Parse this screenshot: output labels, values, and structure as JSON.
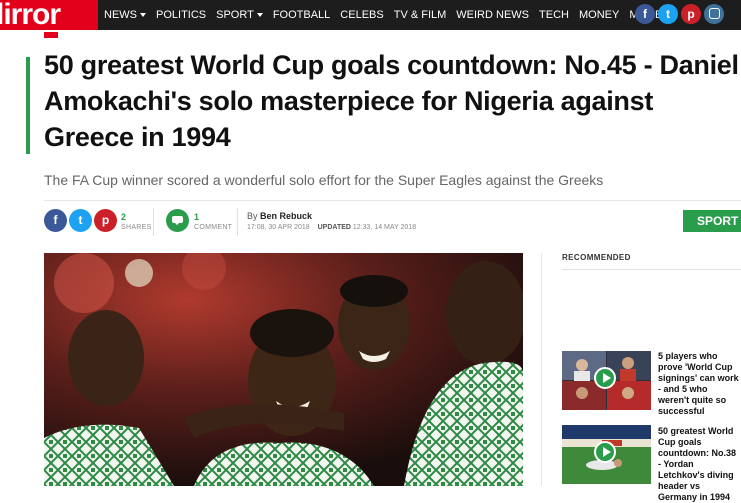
{
  "logo": {
    "text": "lirror"
  },
  "nav": {
    "items": [
      {
        "label": "NEWS",
        "dropdown": true
      },
      {
        "label": "POLITICS",
        "dropdown": false
      },
      {
        "label": "SPORT",
        "dropdown": true
      },
      {
        "label": "FOOTBALL",
        "dropdown": false
      },
      {
        "label": "CELEBS",
        "dropdown": false
      },
      {
        "label": "TV & FILM",
        "dropdown": false
      },
      {
        "label": "WEIRD NEWS",
        "dropdown": false
      },
      {
        "label": "TECH",
        "dropdown": false
      },
      {
        "label": "MONEY",
        "dropdown": false
      },
      {
        "label": "MORE",
        "dropdown": true
      }
    ],
    "social": [
      {
        "icon": "facebook-icon",
        "glyph": "f"
      },
      {
        "icon": "twitter-icon",
        "glyph": "t"
      },
      {
        "icon": "pinterest-icon",
        "glyph": "p"
      },
      {
        "icon": "instagram-icon",
        "glyph": ""
      }
    ]
  },
  "article": {
    "headline": "50 greatest World Cup goals countdown: No.45 - Daniel Amokachi's solo masterpiece for Nigeria against Greece in 1994",
    "standfirst": "The FA Cup winner scored a wonderful solo effort for the Super Eagles against the Greeks",
    "share_count": "2",
    "share_label": "SHARES",
    "comment_count": "1",
    "comment_label": "COMMENT",
    "byline_prefix": "By",
    "author": "Ben Rebuck",
    "published": "17:08, 30 APR 2018",
    "updated_label": "UPDATED",
    "updated": "12:33, 14 MAY 2018",
    "section_tag": "SPORT"
  },
  "recommended": {
    "title": "RECOMMENDED",
    "items": [
      {
        "headline": "5 players who prove 'World Cup signings' can work - and 5 who weren't quite so successful"
      },
      {
        "headline": "50 greatest World Cup goals countdown: No.38 - Yordan Letchkov's diving header vs Germany in 1994"
      }
    ]
  },
  "colors": {
    "brand_red": "#e2001a",
    "nav_dark": "#1d1d1d",
    "sport_green": "#2a9d4c"
  }
}
